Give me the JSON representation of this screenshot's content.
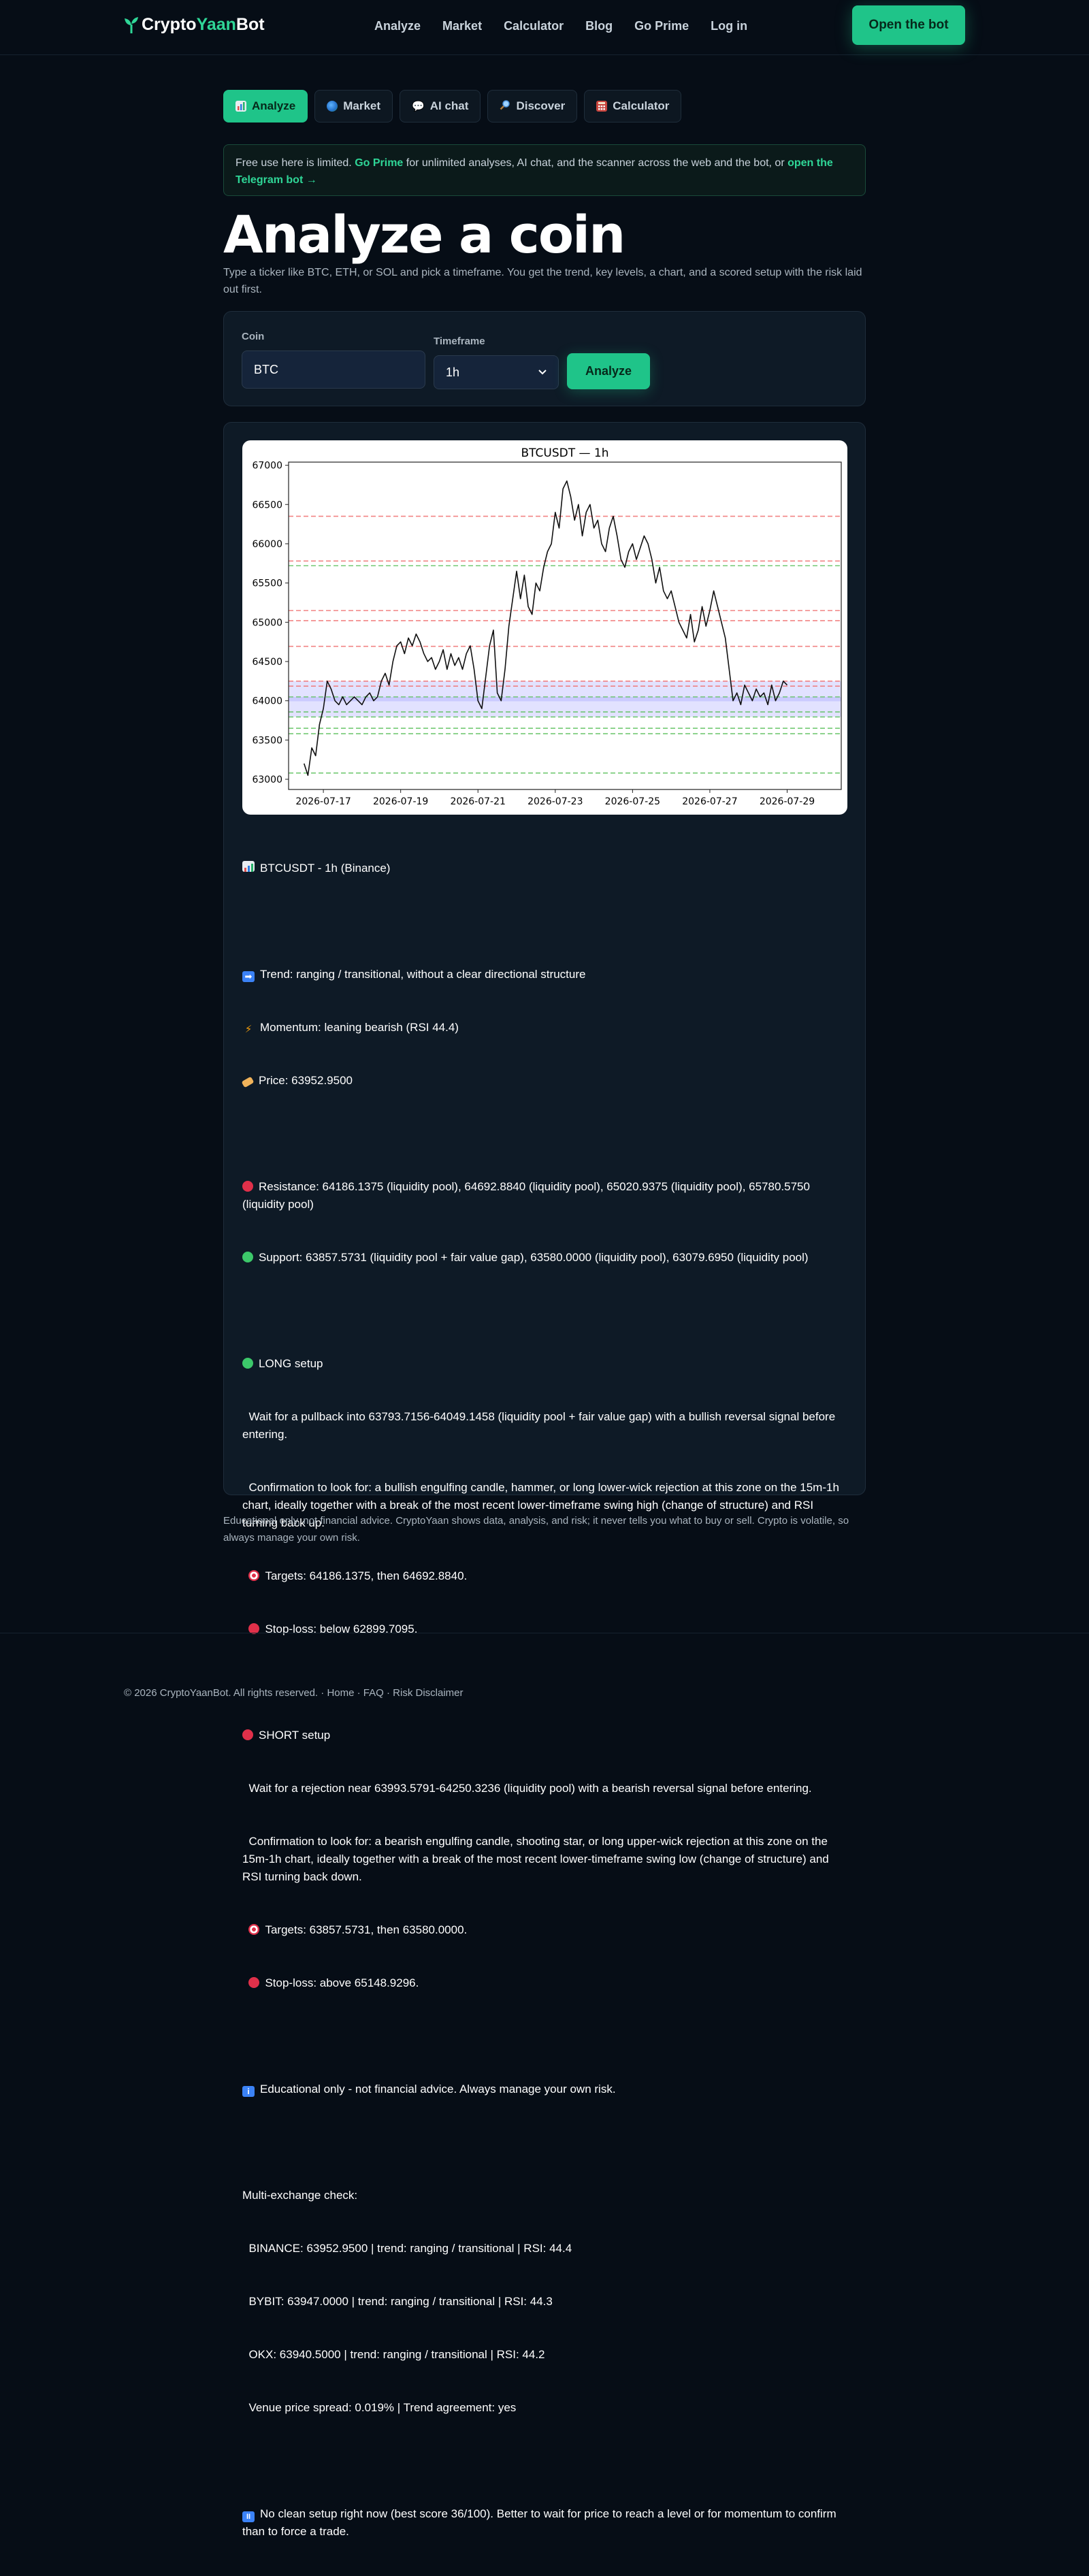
{
  "nav": {
    "logo": {
      "part1": "Crypto",
      "part2": "Yaan",
      "part3": "Bot"
    },
    "links": [
      "Analyze",
      "Market",
      "Calculator",
      "Blog",
      "Go Prime",
      "Log in"
    ],
    "cta": "Open the bot"
  },
  "tabs": [
    {
      "label": "Analyze",
      "icon": "bar-chart-icon",
      "active": true
    },
    {
      "label": "Market",
      "icon": "globe-icon"
    },
    {
      "label": "AI chat",
      "icon": "speech-bubble-icon"
    },
    {
      "label": "Discover",
      "icon": "magnifier-icon"
    },
    {
      "label": "Calculator",
      "icon": "calculator-icon"
    }
  ],
  "notice": {
    "text1": "Free use here is limited. ",
    "link1": "Go Prime",
    "text2": " for unlimited analyses, AI chat, and the scanner across the web and the bot, or ",
    "link2": "open the Telegram bot →"
  },
  "page": {
    "title": "Analyze a coin",
    "subtitle": "Type a ticker like BTC, ETH, or SOL and pick a timeframe. You get the trend, key levels, a chart, and a scored setup with the risk laid out first."
  },
  "form": {
    "coin_label": "Coin",
    "coin_value": "BTC",
    "timeframe_label": "Timeframe",
    "timeframe_value": "1h",
    "button": "Analyze"
  },
  "chart_data": {
    "type": "line",
    "title": "BTCUSDT — 1h",
    "x_ticks": [
      "2026-07-17",
      "2026-07-19",
      "2026-07-21",
      "2026-07-23",
      "2026-07-25",
      "2026-07-27",
      "2026-07-29"
    ],
    "y_ticks": [
      63000,
      63500,
      64000,
      64500,
      65000,
      65500,
      66000,
      66500,
      67000
    ],
    "ylim": [
      62870,
      67040
    ],
    "x_range_days": [
      -0.9,
      13.4
    ],
    "resistance_levels": [
      64186.1375,
      64692.884,
      65020.9375,
      65780.575,
      64250.3236,
      65148.9296,
      66350
    ],
    "support_levels": [
      63857.5731,
      63580.0,
      63079.695,
      63793.7156,
      64049.1458,
      63650,
      65720
    ],
    "zones": [
      [
        63793.7156,
        64049.1458
      ],
      [
        63993.5791,
        64250.3236
      ]
    ],
    "price_series": [
      [
        -0.5,
        63200
      ],
      [
        -0.4,
        63050
      ],
      [
        -0.3,
        63400
      ],
      [
        -0.2,
        63300
      ],
      [
        -0.1,
        63700
      ],
      [
        0.0,
        63900
      ],
      [
        0.1,
        64250
      ],
      [
        0.2,
        64150
      ],
      [
        0.3,
        64000
      ],
      [
        0.4,
        63950
      ],
      [
        0.5,
        64050
      ],
      [
        0.6,
        63950
      ],
      [
        0.7,
        64000
      ],
      [
        0.8,
        64050
      ],
      [
        0.9,
        64000
      ],
      [
        1.0,
        63950
      ],
      [
        1.1,
        64050
      ],
      [
        1.2,
        64100
      ],
      [
        1.3,
        64000
      ],
      [
        1.4,
        64050
      ],
      [
        1.5,
        64250
      ],
      [
        1.6,
        64350
      ],
      [
        1.7,
        64200
      ],
      [
        1.8,
        64500
      ],
      [
        1.9,
        64700
      ],
      [
        2.0,
        64750
      ],
      [
        2.1,
        64600
      ],
      [
        2.2,
        64800
      ],
      [
        2.3,
        64700
      ],
      [
        2.4,
        64850
      ],
      [
        2.5,
        64750
      ],
      [
        2.6,
        64600
      ],
      [
        2.7,
        64500
      ],
      [
        2.8,
        64550
      ],
      [
        2.9,
        64400
      ],
      [
        3.0,
        64500
      ],
      [
        3.1,
        64650
      ],
      [
        3.2,
        64400
      ],
      [
        3.3,
        64600
      ],
      [
        3.4,
        64450
      ],
      [
        3.5,
        64550
      ],
      [
        3.6,
        64400
      ],
      [
        3.7,
        64600
      ],
      [
        3.8,
        64700
      ],
      [
        3.9,
        64400
      ],
      [
        4.0,
        64000
      ],
      [
        4.1,
        63900
      ],
      [
        4.2,
        64300
      ],
      [
        4.3,
        64700
      ],
      [
        4.4,
        64900
      ],
      [
        4.5,
        64100
      ],
      [
        4.6,
        64000
      ],
      [
        4.7,
        64400
      ],
      [
        4.8,
        64950
      ],
      [
        4.9,
        65300
      ],
      [
        5.0,
        65650
      ],
      [
        5.1,
        65300
      ],
      [
        5.2,
        65600
      ],
      [
        5.3,
        65200
      ],
      [
        5.4,
        65100
      ],
      [
        5.5,
        65500
      ],
      [
        5.6,
        65400
      ],
      [
        5.7,
        65700
      ],
      [
        5.8,
        65900
      ],
      [
        5.9,
        66000
      ],
      [
        6.0,
        66400
      ],
      [
        6.1,
        66200
      ],
      [
        6.2,
        66700
      ],
      [
        6.3,
        66800
      ],
      [
        6.4,
        66600
      ],
      [
        6.5,
        66300
      ],
      [
        6.6,
        66500
      ],
      [
        6.7,
        66100
      ],
      [
        6.8,
        66400
      ],
      [
        6.9,
        66500
      ],
      [
        7.0,
        66200
      ],
      [
        7.1,
        66300
      ],
      [
        7.2,
        66000
      ],
      [
        7.3,
        65900
      ],
      [
        7.4,
        66200
      ],
      [
        7.5,
        66350
      ],
      [
        7.6,
        66100
      ],
      [
        7.7,
        65800
      ],
      [
        7.8,
        65700
      ],
      [
        7.9,
        65900
      ],
      [
        8.0,
        66000
      ],
      [
        8.1,
        65800
      ],
      [
        8.2,
        65950
      ],
      [
        8.3,
        66100
      ],
      [
        8.4,
        66000
      ],
      [
        8.5,
        65800
      ],
      [
        8.6,
        65500
      ],
      [
        8.7,
        65700
      ],
      [
        8.8,
        65400
      ],
      [
        8.9,
        65300
      ],
      [
        9.0,
        65400
      ],
      [
        9.1,
        65200
      ],
      [
        9.2,
        65000
      ],
      [
        9.3,
        64900
      ],
      [
        9.4,
        64800
      ],
      [
        9.5,
        65100
      ],
      [
        9.6,
        64750
      ],
      [
        9.7,
        64900
      ],
      [
        9.8,
        65200
      ],
      [
        9.9,
        64950
      ],
      [
        10.0,
        65150
      ],
      [
        10.1,
        65400
      ],
      [
        10.2,
        65200
      ],
      [
        10.3,
        65000
      ],
      [
        10.4,
        64800
      ],
      [
        10.5,
        64400
      ],
      [
        10.6,
        64000
      ],
      [
        10.7,
        64100
      ],
      [
        10.8,
        63950
      ],
      [
        10.9,
        64200
      ],
      [
        11.0,
        64100
      ],
      [
        11.1,
        64000
      ],
      [
        11.2,
        64150
      ],
      [
        11.3,
        64050
      ],
      [
        11.4,
        64100
      ],
      [
        11.5,
        63950
      ],
      [
        11.6,
        64200
      ],
      [
        11.7,
        64000
      ],
      [
        11.8,
        64100
      ],
      [
        11.9,
        64250
      ],
      [
        12.0,
        64200
      ]
    ]
  },
  "report": {
    "header": "BTCUSDT - 1h (Binance)",
    "trend": "Trend: ranging / transitional, without a clear directional structure",
    "momentum": "Momentum: leaning bearish (RSI 44.4)",
    "price": "Price: 63952.9500",
    "resistance": "Resistance: 64186.1375 (liquidity pool), 64692.8840 (liquidity pool), 65020.9375 (liquidity pool), 65780.5750 (liquidity pool)",
    "support": "Support: 63857.5731 (liquidity pool + fair value gap), 63580.0000 (liquidity pool), 63079.6950 (liquidity pool)",
    "long_title": "LONG setup",
    "long_1": "  Wait for a pullback into 63793.7156-64049.1458 (liquidity pool + fair value gap) with a bullish reversal signal before entering.",
    "long_2": "  Confirmation to look for: a bullish engulfing candle, hammer, or long lower-wick rejection at this zone on the 15m-1h chart, ideally together with a break of the most recent lower-timeframe swing high (change of structure) and RSI turning back up.",
    "long_targets": "Targets: 64186.1375, then 64692.8840.",
    "long_stop": "Stop-loss: below 62899.7095.",
    "short_title": "SHORT setup",
    "short_1": "  Wait for a rejection near 63993.5791-64250.3236 (liquidity pool) with a bearish reversal signal before entering.",
    "short_2": "  Confirmation to look for: a bearish engulfing candle, shooting star, or long upper-wick rejection at this zone on the 15m-1h chart, ideally together with a break of the most recent lower-timeframe swing low (change of structure) and RSI turning back down.",
    "short_targets": "Targets: 63857.5731, then 63580.0000.",
    "short_stop": "Stop-loss: above 65148.9296.",
    "edu": "Educational only - not financial advice. Always manage your own risk.",
    "multi_title": "Multi-exchange check:",
    "binance": "  BINANCE: 63952.9500 | trend: ranging / transitional | RSI: 44.4",
    "bybit": "  BYBIT: 63947.0000 | trend: ranging / transitional | RSI: 44.3",
    "okx": "  OKX: 63940.5000 | trend: ranging / transitional | RSI: 44.2",
    "spread": "  Venue price spread: 0.019% | Trend agreement: yes",
    "verdict": "No clean setup right now (best score 36/100). Better to wait for price to reach a level or for momentum to confirm than to force a trade."
  },
  "disclaimer": "Educational only, not financial advice. CryptoYaan shows data, analysis, and risk; it never tells you what to buy or sell. Crypto is volatile, so always manage your own risk.",
  "footer": {
    "copyright": "© 2026 CryptoYaanBot. All rights reserved.",
    "sep": " · ",
    "home": "Home",
    "faq": "FAQ",
    "risk": "Risk Disclaimer"
  },
  "colors": {
    "accent": "#1fc489",
    "background": "#060d16",
    "card": "#0e1a26"
  }
}
